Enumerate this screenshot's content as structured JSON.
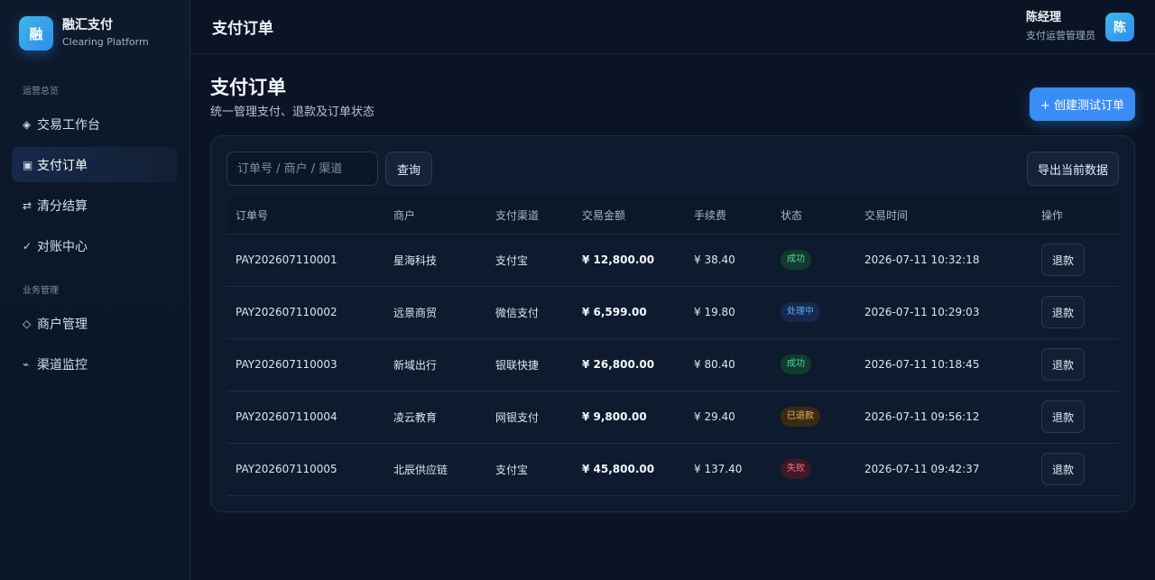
{
  "brand": {
    "logo": "融",
    "name": "融汇支付",
    "subtitle": "Clearing Platform"
  },
  "sidebar": {
    "sections": [
      {
        "title": "运营总览",
        "items": [
          {
            "icon": "◈",
            "label": "交易工作台",
            "active": false
          },
          {
            "icon": "▣",
            "label": "支付订单",
            "active": true
          },
          {
            "icon": "⇄",
            "label": "清分结算",
            "active": false
          },
          {
            "icon": "✓",
            "label": "对账中心",
            "active": false
          }
        ]
      },
      {
        "title": "业务管理",
        "items": [
          {
            "icon": "◇",
            "label": "商户管理",
            "active": false
          },
          {
            "icon": "⌁",
            "label": "渠道监控",
            "active": false
          }
        ]
      }
    ]
  },
  "topbar": {
    "title": "支付订单"
  },
  "user": {
    "name": "陈经理",
    "role": "支付运营管理员",
    "avatar": "陈"
  },
  "page": {
    "title": "支付订单",
    "description": "统一管理支付、退款及订单状态",
    "create_button": "+ 创建测试订单"
  },
  "toolbar": {
    "search_placeholder": "订单号 / 商户 / 渠道",
    "search_value": "",
    "query_button": "查询",
    "export_button": "导出当前数据"
  },
  "table": {
    "headers": [
      "订单号",
      "商户",
      "支付渠道",
      "交易金额",
      "手续费",
      "状态",
      "交易时间",
      "操作"
    ],
    "rows": [
      {
        "id": "PAY202607110001",
        "merchant": "星海科技",
        "channel": "支付宝",
        "amount": "¥ 12,800.00",
        "fee": "¥ 38.40",
        "status": "成功",
        "status_type": "success",
        "time": "2026-07-11 10:32:18",
        "action": "退款"
      },
      {
        "id": "PAY202607110002",
        "merchant": "远景商贸",
        "channel": "微信支付",
        "amount": "¥ 6,599.00",
        "fee": "¥ 19.80",
        "status": "处理中",
        "status_type": "processing",
        "time": "2026-07-11 10:29:03",
        "action": "退款"
      },
      {
        "id": "PAY202607110003",
        "merchant": "新域出行",
        "channel": "银联快捷",
        "amount": "¥ 26,800.00",
        "fee": "¥ 80.40",
        "status": "成功",
        "status_type": "success",
        "time": "2026-07-11 10:18:45",
        "action": "退款"
      },
      {
        "id": "PAY202607110004",
        "merchant": "凌云教育",
        "channel": "网银支付",
        "amount": "¥ 9,800.00",
        "fee": "¥ 29.40",
        "status": "已退款",
        "status_type": "refunded",
        "time": "2026-07-11 09:56:12",
        "action": "退款"
      },
      {
        "id": "PAY202607110005",
        "merchant": "北辰供应链",
        "channel": "支付宝",
        "amount": "¥ 45,800.00",
        "fee": "¥ 137.40",
        "status": "失败",
        "status_type": "failed",
        "time": "2026-07-11 09:42:37",
        "action": "退款"
      }
    ]
  },
  "colors": {
    "accent": "#3a8df5",
    "success": "#4fd89a",
    "processing": "#5ea6ff",
    "refunded": "#f0b45a",
    "failed": "#ff6f8d",
    "background": "#0a1424"
  }
}
